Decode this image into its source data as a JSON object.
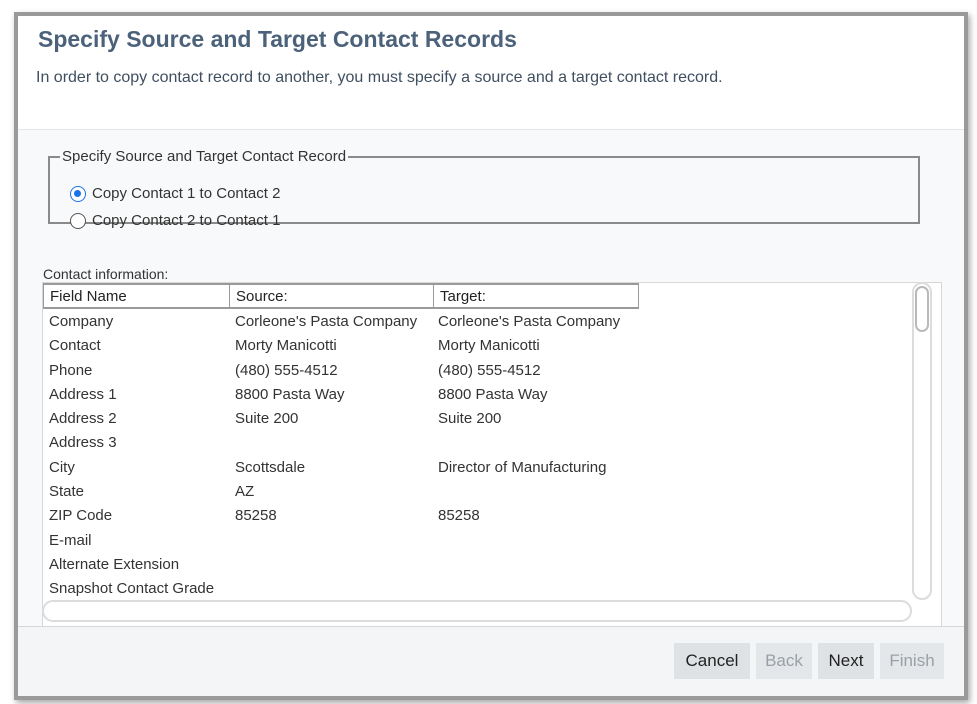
{
  "header": {
    "title": "Specify Source and Target Contact Records",
    "subtitle": "In order to copy contact record to another, you must specify a source and a target contact record."
  },
  "choice": {
    "legend": "Specify Source and Target Contact Record",
    "options": [
      {
        "label": "Copy Contact 1 to Contact 2",
        "selected": true
      },
      {
        "label": "Copy Contact 2 to Contact 1",
        "selected": false
      }
    ]
  },
  "contact_info": {
    "label": "Contact information:",
    "columns": [
      "Field Name",
      "Source:",
      "Target:"
    ],
    "rows": [
      {
        "field": "Company",
        "source": "Corleone's Pasta Company",
        "target": "Corleone's Pasta Company"
      },
      {
        "field": "Contact",
        "source": "Morty Manicotti",
        "target": "Morty Manicotti"
      },
      {
        "field": "Phone",
        "source": "(480) 555-4512",
        "target": "(480) 555-4512"
      },
      {
        "field": "Address 1",
        "source": "8800 Pasta Way",
        "target": "8800 Pasta Way"
      },
      {
        "field": "Address 2",
        "source": "Suite 200",
        "target": "Suite 200"
      },
      {
        "field": "Address 3",
        "source": "",
        "target": ""
      },
      {
        "field": "City",
        "source": "Scottsdale",
        "target": "Director of Manufacturing"
      },
      {
        "field": "State",
        "source": "AZ",
        "target": ""
      },
      {
        "field": "ZIP Code",
        "source": "85258",
        "target": "85258"
      },
      {
        "field": "E-mail",
        "source": "",
        "target": ""
      },
      {
        "field": "Alternate Extension",
        "source": "",
        "target": ""
      },
      {
        "field": "Snapshot Contact Grade",
        "source": "",
        "target": ""
      }
    ]
  },
  "footer": {
    "cancel": "Cancel",
    "back": "Back",
    "next": "Next",
    "finish": "Finish"
  },
  "colors": {
    "title": "#4c627a",
    "radio_accent": "#1a73e8",
    "button_bg": "#dfe2e5",
    "disabled_text": "#9aa0a6"
  }
}
